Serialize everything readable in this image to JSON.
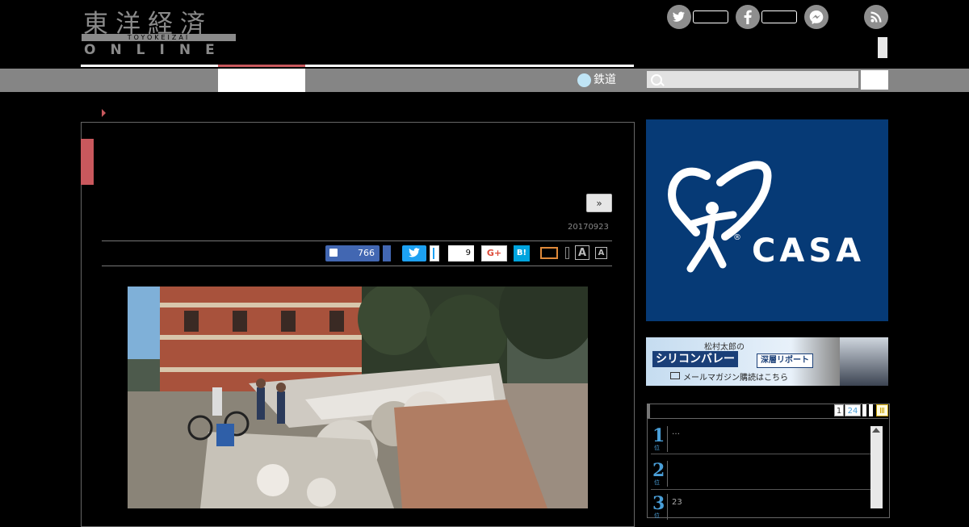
{
  "logo": {
    "kanji": "東洋経済",
    "romaji": "TOYOKEIZAI",
    "online": "ONLINE"
  },
  "social_header": {
    "twitter": "twitter-icon",
    "facebook": "facebook-icon",
    "messenger": "messenger-icon",
    "rss": "rss-icon"
  },
  "nav": {
    "rail_label": "鉄道"
  },
  "article": {
    "next_label": "»",
    "date": "20170923"
  },
  "share": {
    "facebook_count": "766",
    "pocket_count": "9",
    "gplus_label": "G+",
    "hatena_label": "B!",
    "font_large": "A",
    "font_small": "A"
  },
  "ads": {
    "casa_label": "CASA",
    "casa_reg": "®",
    "silicon_author": "松村太郎の",
    "silicon_title": "シリコンバレー",
    "silicon_badge": "深層リポート",
    "silicon_cta": "メールマガジン購読はこちら"
  },
  "ranking": {
    "tabs": [
      "1",
      "24",
      "",
      "",
      "Ⅲ"
    ],
    "items": [
      {
        "rank": "1",
        "sub": "位",
        "text": "…"
      },
      {
        "rank": "2",
        "sub": "位",
        "text": ""
      },
      {
        "rank": "3",
        "sub": "位",
        "text": "23"
      }
    ]
  },
  "colors": {
    "accent": "#c9585d",
    "nav_gray": "#858585",
    "casa_blue": "#063a76",
    "rank_blue": "#4a9fd8"
  }
}
